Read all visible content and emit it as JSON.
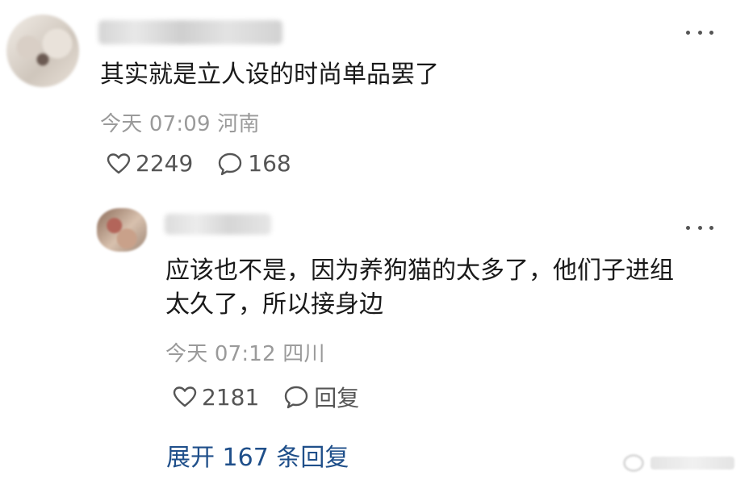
{
  "comment": {
    "text": "其实就是立人设的时尚单品罢了",
    "time": "今天 07:09",
    "location": "河南",
    "likes": "2249",
    "replies": "168"
  },
  "reply": {
    "text_line1": "应该也不是，因为养狗猫的太多了，他们子进组",
    "text_line2": "太久了，所以接身边",
    "time": "今天 07:12",
    "location": "四川",
    "likes": "2181",
    "reply_label": "回复"
  },
  "expand": {
    "label": "展开 167 条回复"
  },
  "icons": {
    "more": "more-dots-icon",
    "like": "heart-outline-icon",
    "comment": "comment-bubble-icon"
  },
  "colors": {
    "text": "#1a1a1a",
    "meta": "#9a9a9a",
    "link": "#1f4f8a"
  }
}
